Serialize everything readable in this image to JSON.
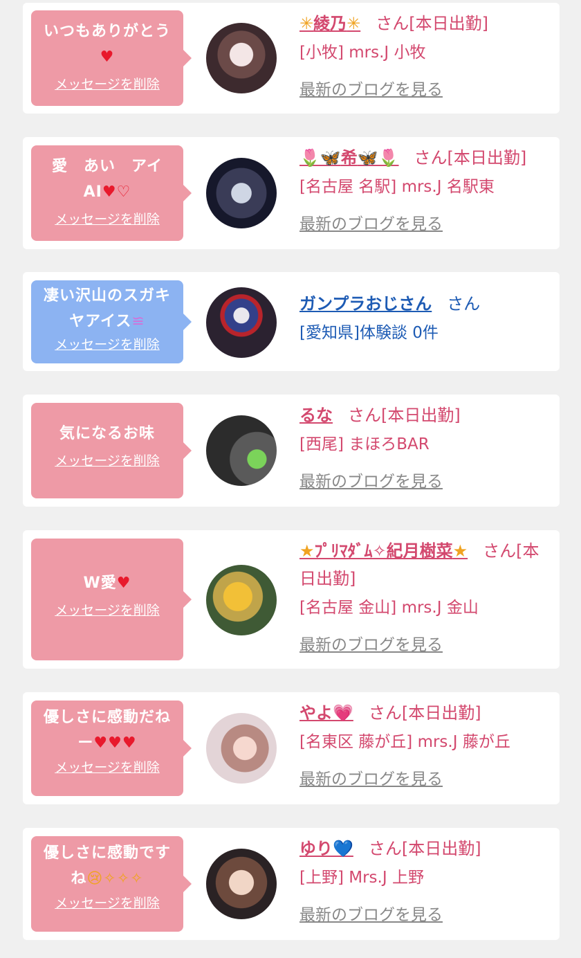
{
  "messages": [
    {
      "text": "いつもありがとう",
      "emoji": "♥",
      "delete_label": "メッセージを削除",
      "name_prefix": "✳",
      "name": "綾乃",
      "name_suffix": "✳",
      "honorific": "さん[本日出勤]",
      "shop": "[小牧] mrs.J 小牧",
      "blog_label": "最新のブログを見る"
    },
    {
      "text": "愛　あい　アイ AI",
      "emoji": "♥♡",
      "delete_label": "メッセージを削除",
      "name_prefix": "🌷🦋",
      "name": "希",
      "name_suffix": "🦋🌷",
      "honorific": "さん[本日出勤]",
      "shop": "[名古屋 名駅] mrs.J 名駅東",
      "blog_label": "最新のブログを見る"
    },
    {
      "text": "凄い沢山のスガキヤアイス",
      "emoji": "≌",
      "delete_label": "メッセージを削除",
      "name_prefix": "",
      "name": "ガンプラおじさん",
      "name_suffix": "",
      "honorific": "さん",
      "shop": "[愛知県]体験談 0件"
    },
    {
      "text": "気になるお味",
      "emoji": "",
      "delete_label": "メッセージを削除",
      "name_prefix": "",
      "name": "るな",
      "name_suffix": "",
      "honorific": "さん[本日出勤]",
      "shop": "[西尾] まほろBAR",
      "blog_label": "最新のブログを見る"
    },
    {
      "text": "W愛",
      "emoji": "♥",
      "delete_label": "メッセージを削除",
      "name_prefix": "★",
      "name": "ﾌﾟﾘﾏﾀﾞﾑ✧紀月樹菜",
      "name_suffix": "★",
      "honorific": "さん[本日出勤]",
      "shop": "[名古屋 金山] mrs.J 金山",
      "blog_label": "最新のブログを見る"
    },
    {
      "text": "優しさに感動だねー",
      "emoji": "♥♥♥",
      "delete_label": "メッセージを削除",
      "name_prefix": "",
      "name": "やよ💗",
      "name_suffix": "",
      "honorific": "さん[本日出勤]",
      "shop": "[名東区 藤が丘] mrs.J 藤が丘",
      "blog_label": "最新のブログを見る"
    },
    {
      "text": "優しさに感動ですね",
      "emoji": "😢✧✧✧",
      "delete_label": "メッセージを削除",
      "name_prefix": "",
      "name": "ゆり💙",
      "name_suffix": "",
      "honorific": "さん[本日出勤]",
      "shop": "[上野] Mrs.J 上野",
      "blog_label": "最新のブログを見る"
    }
  ],
  "colors": {
    "bubble_pink": "#ee9aa6",
    "bubble_blue": "#8cb3f2",
    "name_pink": "#d3486e",
    "name_blue": "#1d5bb4",
    "link_gray": "#888888"
  }
}
